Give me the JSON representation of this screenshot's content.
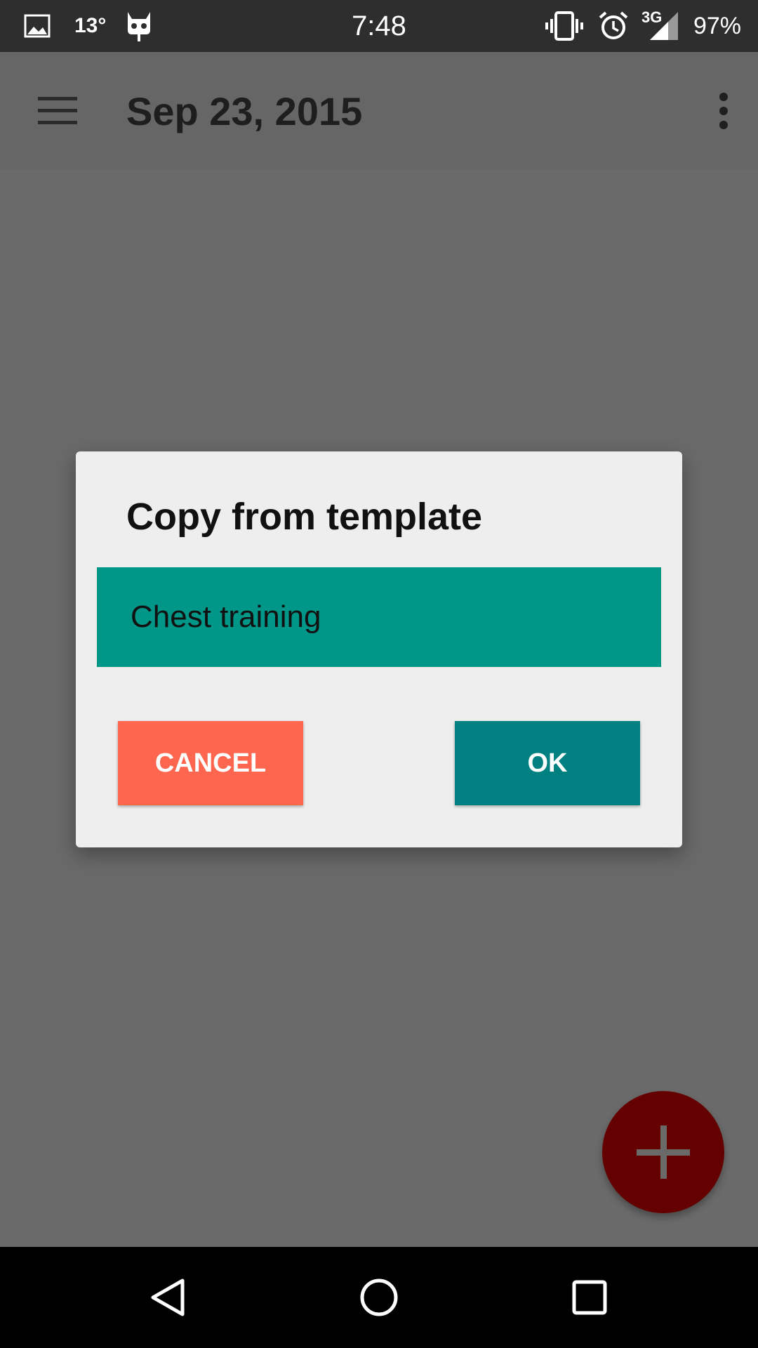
{
  "status_bar": {
    "temperature": "13°",
    "time": "7:48",
    "network": "3G",
    "battery": "97%",
    "icons": [
      "image-icon",
      "cyanogen-mascot-icon",
      "vibrate-icon",
      "alarm-icon",
      "signal-icon"
    ]
  },
  "app_bar": {
    "title": "Sep 23, 2015",
    "icons": [
      "menu-icon",
      "more-vert-icon"
    ]
  },
  "dialog": {
    "title": "Copy from template",
    "items": [
      {
        "label": "Chest training",
        "selected": true
      }
    ],
    "cancel_label": "CANCEL",
    "ok_label": "OK"
  },
  "fab": {
    "icon": "add-icon"
  },
  "nav_bar": {
    "icons": [
      "back-icon",
      "home-icon",
      "recents-icon"
    ]
  },
  "colors": {
    "status_bar": "#2e2e2e",
    "scrim": "#6a6a6a",
    "template_item": "#009688",
    "cancel_button": "#ff6650",
    "ok_button": "#008080",
    "fab": "#640000"
  }
}
